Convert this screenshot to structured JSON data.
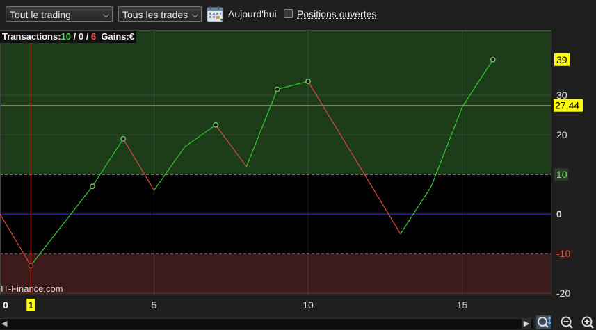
{
  "toolbar": {
    "scope_select": "Tout le trading",
    "trades_select": "Tous les trades",
    "today_label": "Aujourd'hui",
    "positions_label": "Positions ouvertes",
    "positions_checked": false
  },
  "status": {
    "label": "Transactions:",
    "wins": "10",
    "sep1": " / ",
    "neutral": "0",
    "sep2": " / ",
    "losses": "6",
    "gains_label": "Gains:",
    "currency": "€"
  },
  "watermark": "IT-Finance.com",
  "colors": {
    "gain": "#33cc33",
    "loss": "#e04a3a",
    "neutral": "#cccccc",
    "zone_gain": "#1c3c1a",
    "zone_loss": "#3d1b1b",
    "current_marker": "#ffff00",
    "zero_line": "#2a2aee"
  },
  "chart_data": {
    "type": "line",
    "x": [
      0,
      1,
      3,
      4,
      5,
      6,
      7,
      8,
      9,
      10,
      13,
      14,
      15,
      16
    ],
    "y": [
      0,
      -13,
      7,
      19,
      6,
      17,
      22.5,
      12,
      31.5,
      33.5,
      -5,
      7,
      27,
      39
    ],
    "markers": [
      1,
      3,
      4,
      7,
      9,
      10,
      16
    ],
    "xlim": [
      0,
      17.9
    ],
    "ylim": [
      -20.5,
      46.5
    ],
    "x_ticks": [
      0,
      5,
      10,
      15
    ],
    "y_ticks": [
      -20,
      -10,
      0,
      10,
      20,
      30
    ],
    "gain_zone_from": 10,
    "loss_zone_to": -10,
    "last_value_label": "39",
    "reference_value": 27.44,
    "reference_label": "27,44",
    "cursor_x": 1,
    "cursor_label": "1",
    "grid": true
  }
}
